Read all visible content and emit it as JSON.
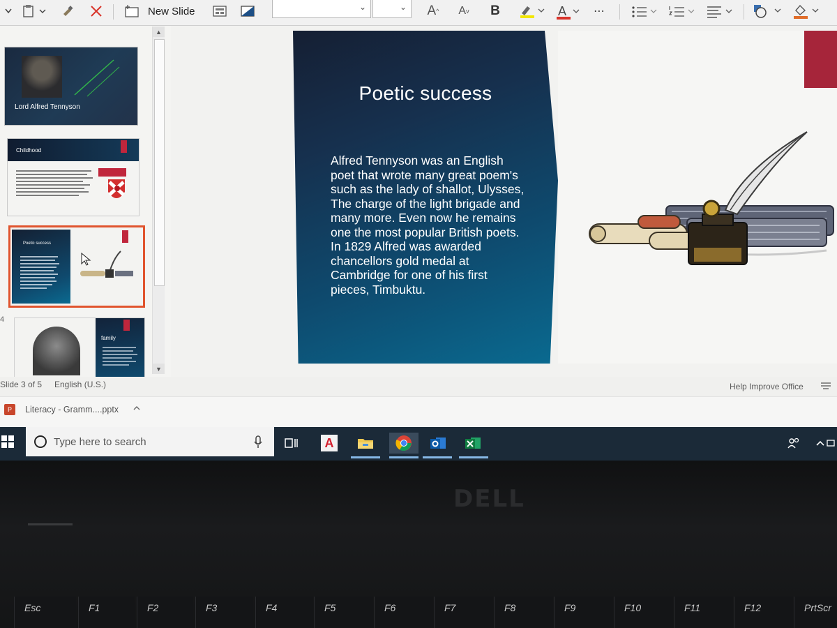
{
  "ribbon": {
    "new_slide_label": "New Slide",
    "font_grow": "A",
    "font_shrink": "A",
    "bold": "B",
    "text_highlight": "A",
    "font_color": "A",
    "more": "⋯"
  },
  "thumbnails": [
    {
      "title": "Lord Alfred Tennyson"
    },
    {
      "title": "Childhood"
    },
    {
      "title": "Poetic success"
    },
    {
      "number": "4",
      "title": "family"
    }
  ],
  "slide": {
    "title": "Poetic success",
    "body": "Alfred Tennyson was an English poet that wrote many great poem's such as the lady of shallot, Ulysses, The charge of the light brigade and many more. Even now he remains one the most popular British poets. In 1829 Alfred was awarded chancellors gold medal at Cambridge for one of his first pieces, Timbuktu.",
    "accent_color": "#a6253a"
  },
  "status": {
    "slide_counter": "Slide 3 of 5",
    "language": "English (U.S.)",
    "help_improve": "Help Improve Office"
  },
  "download": {
    "file_name": "Literacy - Gramm....pptx"
  },
  "taskbar": {
    "search_placeholder": "Type here to search",
    "task_view_icon": "task-view-icon",
    "apps": [
      "acrobat-icon",
      "file-explorer-icon",
      "chrome-icon",
      "outlook-icon",
      "excel-icon"
    ]
  },
  "laptop": {
    "brand": "DELL",
    "keys": [
      "Esc",
      "F1",
      "F2",
      "F3",
      "F4",
      "F5",
      "F6",
      "F7",
      "F8",
      "F9",
      "F10",
      "F11",
      "F12",
      "PrtScr"
    ]
  }
}
